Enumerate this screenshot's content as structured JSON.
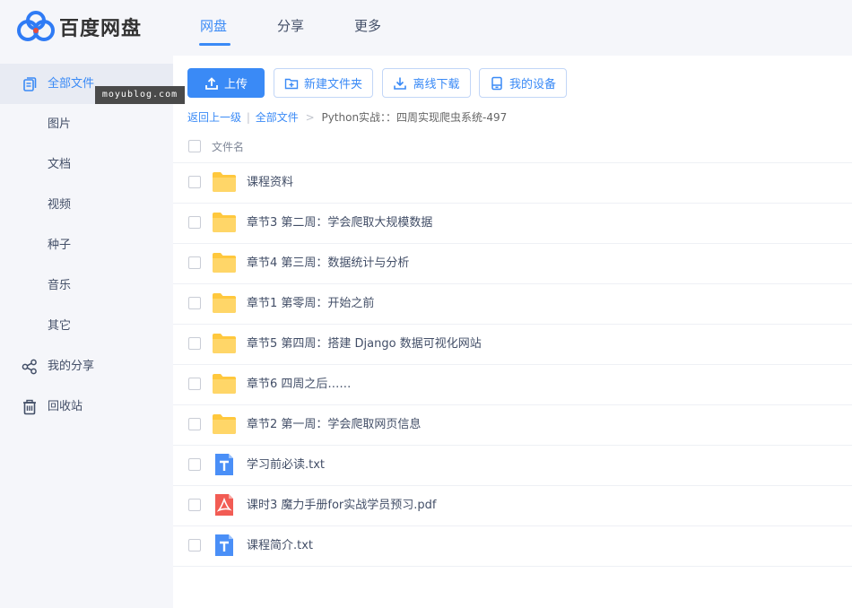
{
  "brand": {
    "name": "百度网盘"
  },
  "topnav": {
    "tabs": [
      {
        "label": "网盘"
      },
      {
        "label": "分享"
      },
      {
        "label": "更多"
      }
    ]
  },
  "sidebar": {
    "items": [
      {
        "label": "全部文件",
        "icon": "files-icon"
      },
      {
        "label": "图片"
      },
      {
        "label": "文档"
      },
      {
        "label": "视频"
      },
      {
        "label": "种子"
      },
      {
        "label": "音乐"
      },
      {
        "label": "其它"
      },
      {
        "label": "我的分享",
        "icon": "share-icon"
      },
      {
        "label": "回收站",
        "icon": "trash-icon"
      }
    ]
  },
  "watermark": "moyublog.com",
  "toolbar": {
    "upload": "上传",
    "new_folder": "新建文件夹",
    "offline_download": "离线下载",
    "my_devices": "我的设备"
  },
  "breadcrumb": {
    "back": "返回上一级",
    "divider": "|",
    "root": "全部文件",
    "sep": ">",
    "current": "Python实战：：四周实现爬虫系统-497"
  },
  "list": {
    "column_name": "文件名",
    "rows": [
      {
        "name": "课程资料",
        "type": "folder"
      },
      {
        "name": "章节3 第二周：学会爬取大规模数据",
        "type": "folder"
      },
      {
        "name": "章节4 第三周：数据统计与分析",
        "type": "folder"
      },
      {
        "name": "章节1 第零周：开始之前",
        "type": "folder"
      },
      {
        "name": "章节5 第四周：搭建 Django 数据可视化网站",
        "type": "folder"
      },
      {
        "name": "章节6 四周之后……",
        "type": "folder"
      },
      {
        "name": "章节2 第一周：学会爬取网页信息",
        "type": "folder"
      },
      {
        "name": "学习前必读.txt",
        "type": "txt"
      },
      {
        "name": "课时3 魔力手册for实战学员预习.pdf",
        "type": "pdf"
      },
      {
        "name": "课程简介.txt",
        "type": "txt"
      }
    ]
  },
  "colors": {
    "accent": "#3a8af6",
    "folder": "#ffd25f",
    "pdf": "#f25c54",
    "sidebar_bg": "#f5f6fa"
  }
}
